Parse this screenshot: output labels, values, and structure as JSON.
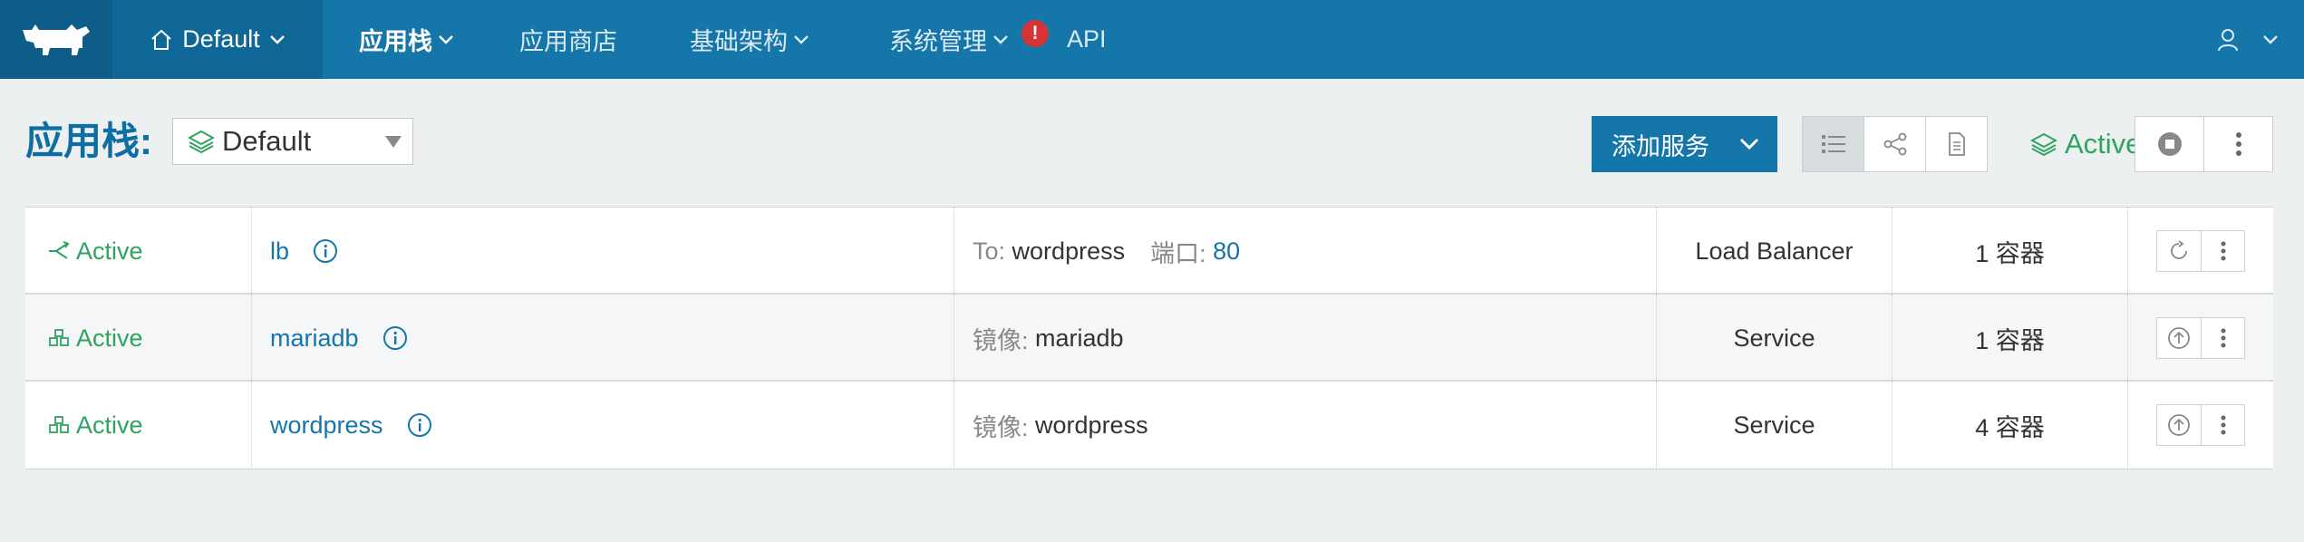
{
  "header": {
    "environment": "Default",
    "nav": [
      {
        "label": "应用栈",
        "active": true,
        "dropdown": true
      },
      {
        "label": "应用商店",
        "active": false,
        "dropdown": false
      },
      {
        "label": "基础架构",
        "active": false,
        "dropdown": true
      },
      {
        "label": "系统管理",
        "active": false,
        "dropdown": true,
        "alert": "!"
      },
      {
        "label": "API",
        "active": false,
        "dropdown": false
      }
    ],
    "icons": {
      "logo": "rancher-cow-logo",
      "home": "home-icon",
      "user": "user-icon"
    }
  },
  "toolbar": {
    "title": "应用栈:",
    "stack_select": "Default",
    "add_service": "添加服务",
    "state": "Active",
    "view_icons": [
      "list-view-icon",
      "graph-view-icon",
      "compose-file-icon"
    ]
  },
  "colors": {
    "brand": "#1576a9",
    "active": "#2fa35f",
    "alert": "#d63434"
  },
  "services": [
    {
      "state": "Active",
      "state_icon": "balancer-icon",
      "name": "lb",
      "detail_prefix": "To:",
      "detail_value": "wordpress",
      "port_label": "端口:",
      "port_value": "80",
      "kind": "Load Balancer",
      "scale": "1 容器",
      "action_icon": "restart-icon"
    },
    {
      "state": "Active",
      "state_icon": "service-icon",
      "name": "mariadb",
      "detail_prefix": "镜像:",
      "detail_value": "mariadb",
      "kind": "Service",
      "scale": "1 容器",
      "action_icon": "upgrade-icon"
    },
    {
      "state": "Active",
      "state_icon": "service-icon",
      "name": "wordpress",
      "detail_prefix": "镜像:",
      "detail_value": "wordpress",
      "kind": "Service",
      "scale": "4 容器",
      "action_icon": "upgrade-icon"
    }
  ]
}
